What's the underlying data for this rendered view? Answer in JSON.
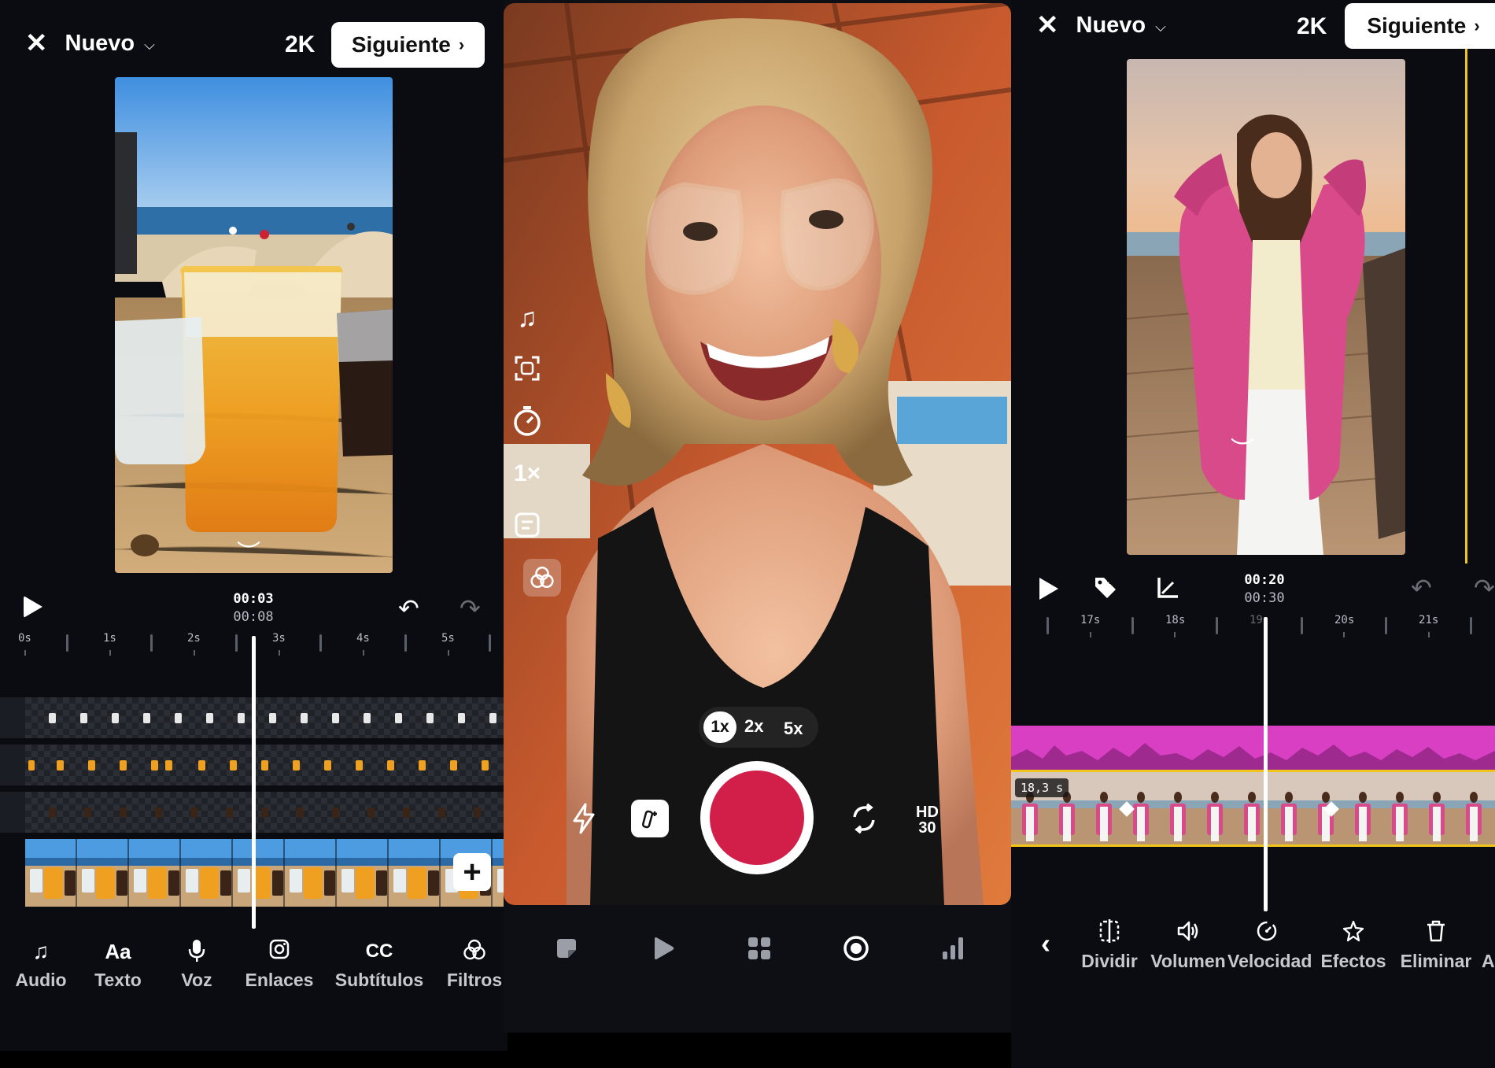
{
  "colors": {
    "record": "#d21f4a",
    "accent_yellow": "#f0c419",
    "audio_track": "#d93fc3",
    "bg": "#0a0c11"
  },
  "panel_left": {
    "header": {
      "title": "Nuevo",
      "resolution": "2K",
      "next_label": "Siguiente"
    },
    "playback": {
      "current_time": "00:03",
      "total_time": "00:08"
    },
    "ruler_labels": [
      "0s",
      "1s",
      "2s",
      "3s",
      "4s",
      "5s"
    ],
    "toolbar": [
      {
        "icon": "music-note-icon",
        "glyph": "♫",
        "label": "Audio"
      },
      {
        "icon": "text-icon",
        "glyph": "Aa",
        "label": "Texto"
      },
      {
        "icon": "microphone-icon",
        "glyph": "🎙",
        "label": "Voz"
      },
      {
        "icon": "instagram-icon",
        "glyph": "◎",
        "label": "Enlaces"
      },
      {
        "icon": "captions-icon",
        "glyph": "CC",
        "label": "Subtítulos"
      },
      {
        "icon": "filters-icon",
        "glyph": "⚭",
        "label": "Filtros"
      }
    ]
  },
  "panel_middle": {
    "zoom_options": [
      "1x",
      "2x",
      "5x"
    ],
    "zoom_selected": "1x",
    "side_tools": [
      {
        "icon": "music-icon",
        "glyph": "♫"
      },
      {
        "icon": "face-scan-icon",
        "glyph": "⬚"
      },
      {
        "icon": "timer-icon",
        "glyph": "◷"
      },
      {
        "icon": "speed-icon",
        "glyph": "1×"
      },
      {
        "icon": "layout-icon",
        "glyph": "▤"
      },
      {
        "icon": "filters-icon",
        "glyph": "⚭"
      }
    ],
    "quality_line1": "HD",
    "quality_line2": "30",
    "bottom_nav": [
      "sticker-icon",
      "play-icon",
      "grid-icon",
      "record-icon",
      "stats-icon"
    ]
  },
  "panel_right": {
    "header": {
      "title": "Nuevo",
      "resolution": "2K",
      "next_label": "Siguiente"
    },
    "playback": {
      "current_time": "00:20",
      "total_time": "00:30"
    },
    "ruler_labels": [
      "17s",
      "18s",
      "19",
      "20s",
      "21s"
    ],
    "clip_duration": "18,3 s",
    "toolbar": [
      {
        "icon": "split-icon",
        "glyph": "⫿",
        "label": "Dividir"
      },
      {
        "icon": "volume-icon",
        "glyph": "🔊",
        "label": "Volumen"
      },
      {
        "icon": "speed-icon",
        "glyph": "◷",
        "label": "Velocidad"
      },
      {
        "icon": "effects-icon",
        "glyph": "✧",
        "label": "Efectos"
      },
      {
        "icon": "trash-icon",
        "glyph": "🗑",
        "label": "Eliminar"
      },
      {
        "icon": "more-icon",
        "glyph": "",
        "label": "A"
      }
    ]
  }
}
